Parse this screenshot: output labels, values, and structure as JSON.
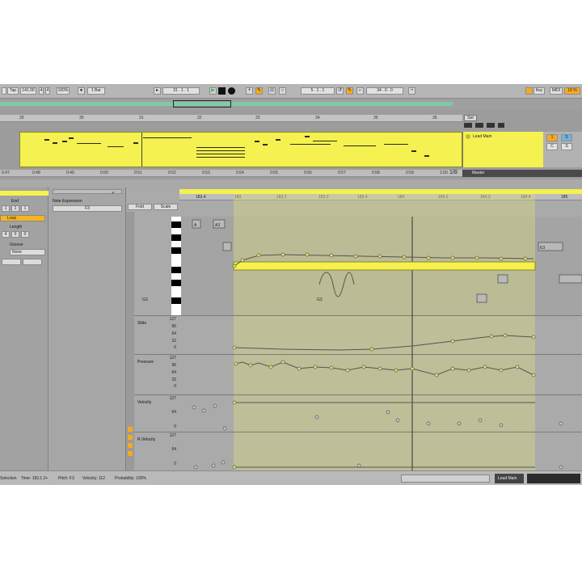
{
  "transport": {
    "tap": "Tap",
    "tempo": "141.00",
    "meter_num": "4",
    "meter_den": "4",
    "zoom": "100%",
    "quantize": "1 Bar",
    "position": "31 . 1 . 1",
    "loop_start": "5 . 1 . 1",
    "loop_length": "34 . 0 . 0",
    "key": "Key",
    "midi": "MIDI",
    "cpu": "16 %"
  },
  "arrangement": {
    "ruler_top": [
      "29",
      "30",
      "31",
      "32",
      "33",
      "34",
      "35",
      "36"
    ],
    "ruler_bottom": [
      "0:47",
      "0:48",
      "0:49",
      "0:50",
      "0:51",
      "0:52",
      "0:53",
      "0:54",
      "0:55",
      "0:56",
      "0:57",
      "0:58",
      "0:59",
      "1:00"
    ],
    "track_name": "Lead Main",
    "master_name": "Master",
    "fraction": "1/8",
    "set_label": "Set",
    "mix_values": [
      "1",
      "S",
      "C",
      "S"
    ]
  },
  "left_panel": {
    "end_label": "End",
    "end_values": [
      "1",
      "1",
      "1"
    ],
    "loop_label": "Loop",
    "length_label": "Length",
    "length_values": [
      "4",
      "0",
      "0"
    ],
    "groove_label": "Groove",
    "groove_value": "None"
  },
  "expression_panel": {
    "title": "Note Expression",
    "note_value": "F3"
  },
  "detail_ruler": [
    "183.4",
    "183",
    "183.2",
    "183.3",
    "183.4",
    "184",
    "184.2",
    "184.3",
    "184.4",
    "185"
  ],
  "detail_toolbar": {
    "fold": "Fold",
    "scale": "Scale"
  },
  "note_labels": [
    "A",
    "A3",
    "G3",
    "G3",
    "E3"
  ],
  "lanes": [
    {
      "name": "Slide",
      "scale": [
        "127",
        "96",
        "64",
        "32",
        "0"
      ]
    },
    {
      "name": "Pressure",
      "scale": [
        "127",
        "96",
        "64",
        "32",
        "0"
      ]
    },
    {
      "name": "Velocity",
      "scale": [
        "127",
        "64",
        "0"
      ]
    },
    {
      "name": "R.Velocity",
      "scale": [
        "127",
        "64",
        "0"
      ]
    }
  ],
  "status": {
    "selection": "Selection",
    "time": "Time: 183.1.2+",
    "pitch": "Pitch: F3",
    "velocity": "Velocity: 112",
    "probability": "Probability: 100%",
    "footer_track": "Lead Main"
  },
  "colors": {
    "clip_yellow": "#f4f150",
    "accent_orange": "#f6a920",
    "selection_tint": "#d6d682",
    "play_green": "#2ec04a"
  },
  "icons": [
    "play-icon",
    "stop-icon",
    "record-icon",
    "loop-icon",
    "pencil-icon",
    "metronome-icon",
    "chevron-down-icon"
  ]
}
